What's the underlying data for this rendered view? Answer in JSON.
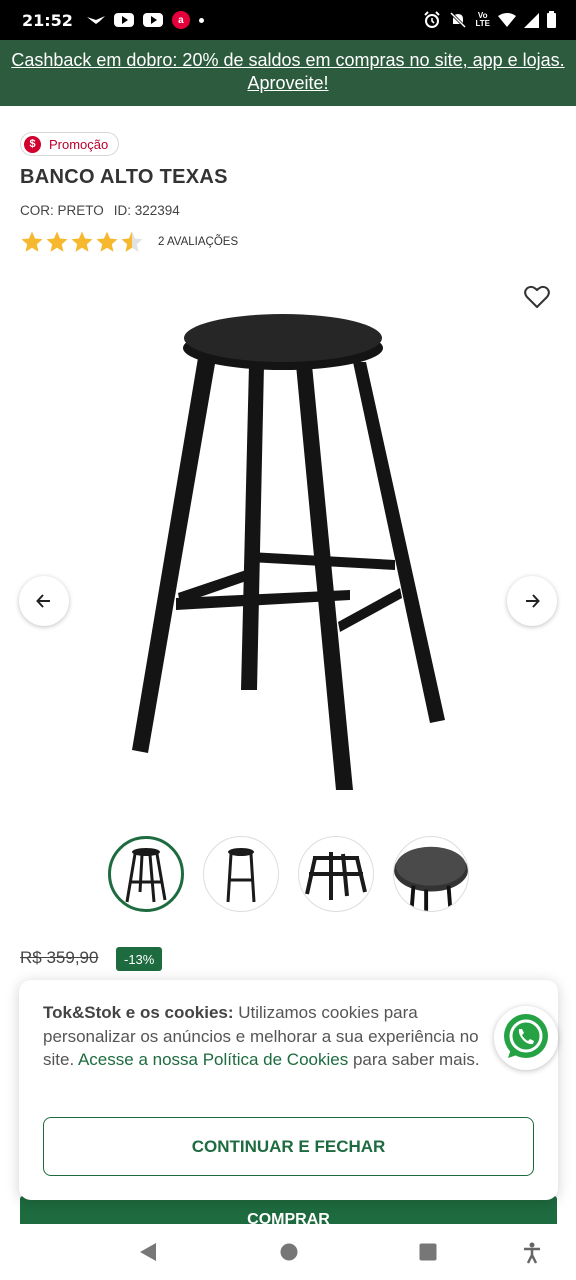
{
  "status_bar": {
    "time": "21:52",
    "red_app_letter": "a",
    "network_label_top": "Vo",
    "network_label_bottom": "LTE"
  },
  "banner": {
    "text": "Cashback em dobro: 20% de saldos em compras no site, app e lojas. Aproveite!",
    "background": "#2d5b3e"
  },
  "product": {
    "badge_symbol": "$",
    "badge_label": "Promoção",
    "title": "BANCO ALTO TEXAS",
    "color_label": "COR: PRETO",
    "id_label": "ID: 322394",
    "rating_value": 4.5,
    "rating_max": 5,
    "rating_count_label": "2 AVALIAÇÕES",
    "old_price": "R$ 359,90",
    "discount": "-13%"
  },
  "gallery": {
    "thumbnail_count": 4,
    "active_index": 0
  },
  "cookie_notice": {
    "brand_lead": "Tok&Stok e os cookies:",
    "text_1": " Utilizamos cookies para personalizar os anúncios e melhorar a sua experiência no site. ",
    "link_text": "Acesse a nossa Política de Cookies",
    "text_2": " para saber mais.",
    "button_label": "CONTINUAR E FECHAR"
  },
  "buy_button_label": "COMPRAR",
  "colors": {
    "accent_green": "#1e6b3f",
    "star": "#f5b82e",
    "promo_red": "#d1002f"
  },
  "icons": [
    "heart-icon",
    "arrow-left-icon",
    "arrow-right-icon",
    "whatsapp-icon",
    "back-icon",
    "home-icon",
    "recents-icon",
    "accessibility-icon"
  ]
}
